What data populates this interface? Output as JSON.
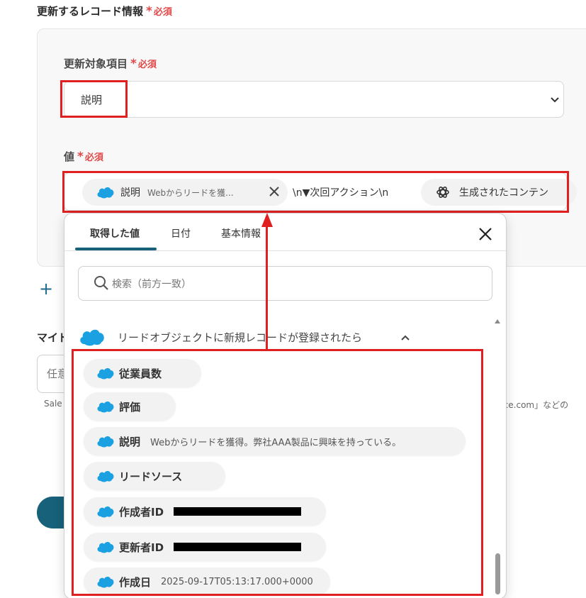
{
  "section": {
    "title": "更新するレコード情報",
    "required_star": "*",
    "required_label": "必須"
  },
  "field_target": {
    "label": "更新対象項目",
    "required_star": "*",
    "required_label": "必須",
    "selected_value": "説明"
  },
  "field_value": {
    "label": "値",
    "required_star": "*",
    "required_label": "必須",
    "chip1": {
      "label": "説明",
      "value": "Webからリードを獲..."
    },
    "between_text": "\\n▼次回アクション\\n",
    "chip2": {
      "label": "生成されたコンテン"
    }
  },
  "add_button": {
    "symbol": "+"
  },
  "my_section": {
    "label": "マイド",
    "input_text": "任意",
    "hint_left": "Sale",
    "hint_right": "rce.com」などの"
  },
  "popup": {
    "tabs": [
      {
        "label": "取得した値",
        "active": true
      },
      {
        "label": "日付",
        "active": false
      },
      {
        "label": "基本情報",
        "active": false
      }
    ],
    "search_placeholder": "検索（前方一致）",
    "group_title": "リードオブジェクトに新規レコードが登録されたら",
    "items": [
      {
        "label": "従業員数",
        "value": ""
      },
      {
        "label": "評価",
        "value": ""
      },
      {
        "label": "説明",
        "value": "Webからリードを獲得。弊社AAA製品に興味を持っている。"
      },
      {
        "label": "リードソース",
        "value": ""
      },
      {
        "label": "作成者ID",
        "value": "",
        "redacted": true
      },
      {
        "label": "更新者ID",
        "value": "",
        "redacted": true
      },
      {
        "label": "作成日",
        "value": "2025-09-17T05:13:17.000+0000"
      }
    ]
  },
  "colors": {
    "accent": "#17617a",
    "required": "#e04848",
    "highlight": "#e02020",
    "salesforce": "#1ba1e2"
  }
}
